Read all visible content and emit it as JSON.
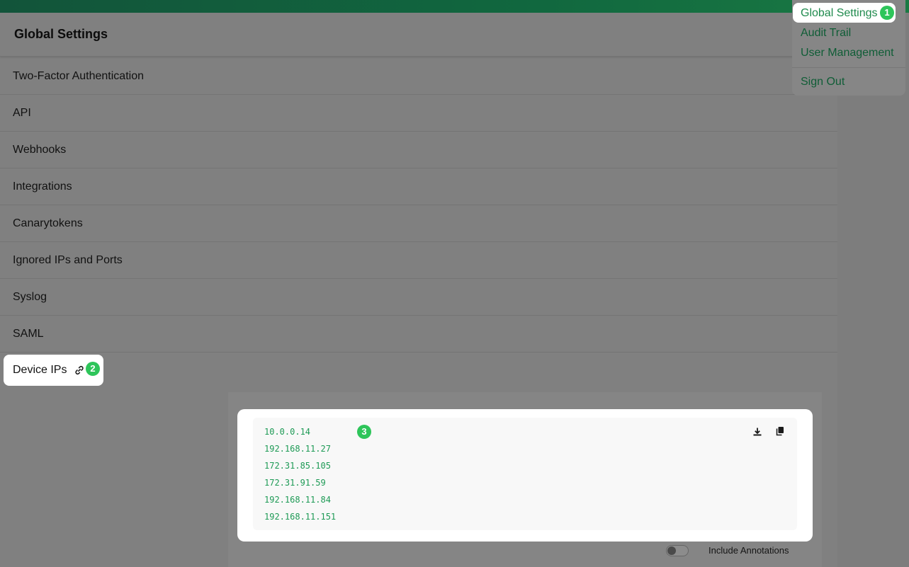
{
  "page": {
    "title": "Global Settings"
  },
  "settings_rows": [
    {
      "label": "Two-Factor Authentication"
    },
    {
      "label": "API"
    },
    {
      "label": "Webhooks"
    },
    {
      "label": "Integrations"
    },
    {
      "label": "Canarytokens"
    },
    {
      "label": "Ignored IPs and Ports"
    },
    {
      "label": "Syslog"
    },
    {
      "label": "SAML"
    }
  ],
  "device_ips": {
    "label": "Device IPs",
    "link_icon": "link-icon",
    "ips": [
      "10.0.0.14",
      "192.168.11.27",
      "172.31.85.105",
      "172.31.91.59",
      "192.168.11.84",
      "192.168.11.151"
    ],
    "download_icon": "download-icon",
    "copy_icon": "copy-icon",
    "include_annotations_label": "Include Annotations",
    "include_annotations_enabled": false
  },
  "dropdown_menu": {
    "items": [
      {
        "label": "Global Settings",
        "active": true
      },
      {
        "label": "Audit Trail",
        "active": false
      },
      {
        "label": "User Management",
        "active": false
      }
    ],
    "sign_out_label": "Sign Out"
  },
  "badges": {
    "one": "1",
    "two": "2",
    "three": "3"
  },
  "colors": {
    "accent_green": "#2ec55a",
    "link_green": "#1f8a4d",
    "ip_text_green": "#1d9a55",
    "topbar_green": "#11683f"
  }
}
